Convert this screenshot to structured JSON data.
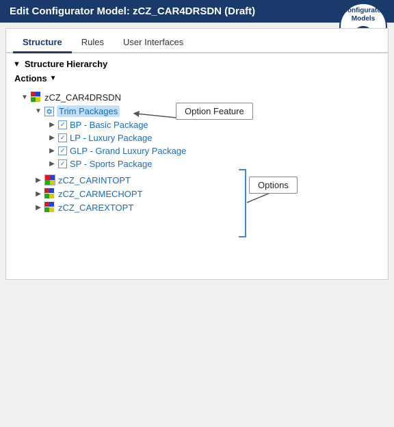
{
  "header": {
    "title": "Edit Configurator Model: zCZ_CAR4DRSDN (Draft)"
  },
  "logo": {
    "line1": "Configurator",
    "line2": "Models"
  },
  "tabs": [
    {
      "id": "structure",
      "label": "Structure",
      "active": true
    },
    {
      "id": "rules",
      "label": "Rules",
      "active": false
    },
    {
      "id": "user-interfaces",
      "label": "User Interfaces",
      "active": false
    }
  ],
  "section": {
    "title": "Structure Hierarchy"
  },
  "actions": {
    "label": "Actions"
  },
  "tree": {
    "root": {
      "label": "zCZ_CAR4DRSDN"
    },
    "feature": {
      "label": "Trim Packages"
    },
    "options": [
      {
        "label": "BP - Basic Package"
      },
      {
        "label": "LP - Luxury Package"
      },
      {
        "label": "GLP - Grand Luxury Package"
      },
      {
        "label": "SP - Sports Package"
      }
    ],
    "items": [
      {
        "label": "zCZ_CARINTOPT"
      },
      {
        "label": "zCZ_CARMECHOPT"
      },
      {
        "label": "zCZ_CAREXTOPT"
      }
    ]
  },
  "callouts": {
    "option_feature": "Option Feature",
    "options": "Options"
  }
}
